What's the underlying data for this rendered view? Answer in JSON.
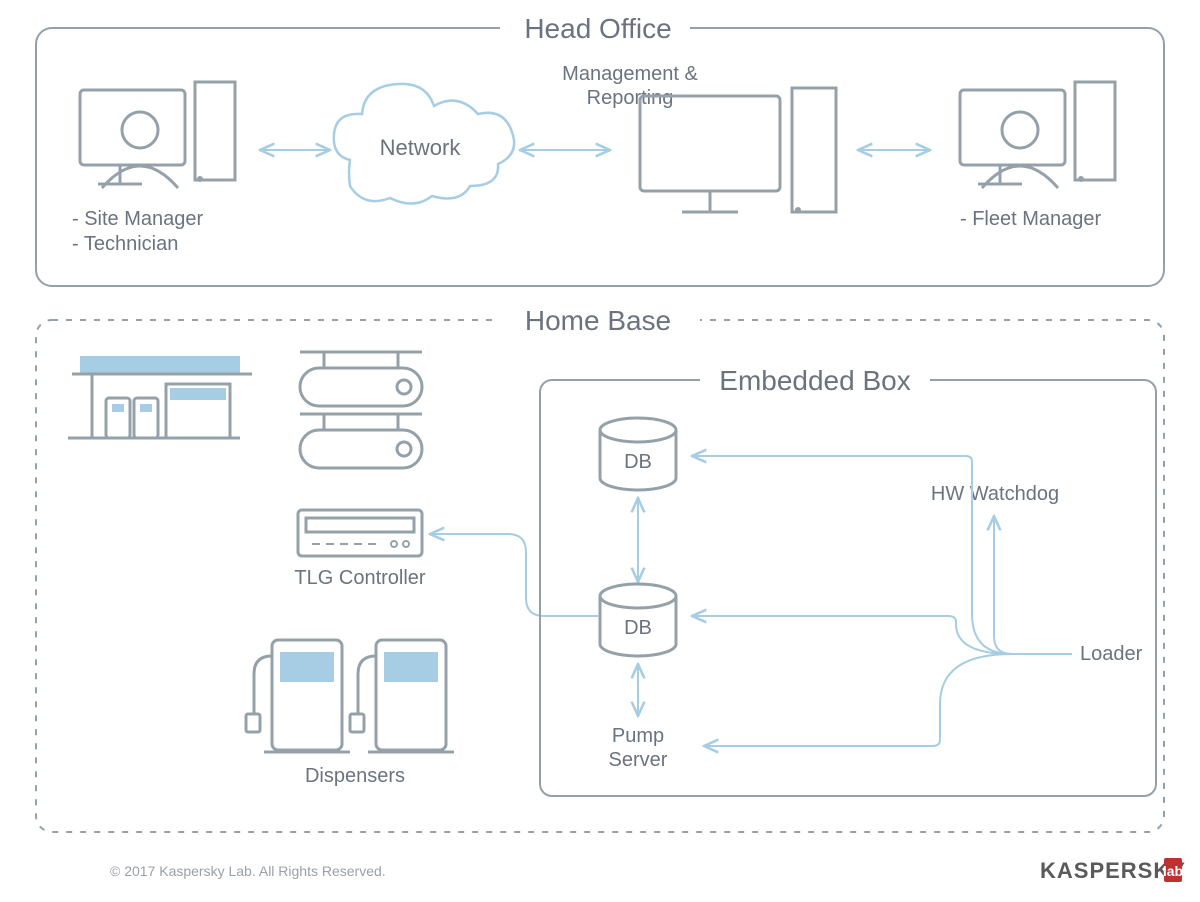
{
  "head_office": {
    "title": "Head Office",
    "left_roles": [
      "- Site Manager",
      "- Technician"
    ],
    "network_label": "Network",
    "mgmt_line1": "Management &",
    "mgmt_line2": "Reporting",
    "right_role": "- Fleet Manager"
  },
  "home_base": {
    "title": "Home Base",
    "tlg": "TLG Controller",
    "dispensers": "Dispensers",
    "embedded_title": "Embedded Box",
    "db1": "DB",
    "db2": "DB",
    "pump1": "Pump",
    "pump2": "Server",
    "hw_watchdog": "HW Watchdog",
    "loader": "Loader"
  },
  "footer": {
    "copyright": "© 2017 Kaspersky Lab. All Rights Reserved.",
    "brand": "KASPERSKY"
  },
  "colors": {
    "line_gray": "#94a1a9",
    "line_blue": "#a6cde3",
    "fill_blue": "#a6cde3",
    "text": "#6b7380"
  }
}
